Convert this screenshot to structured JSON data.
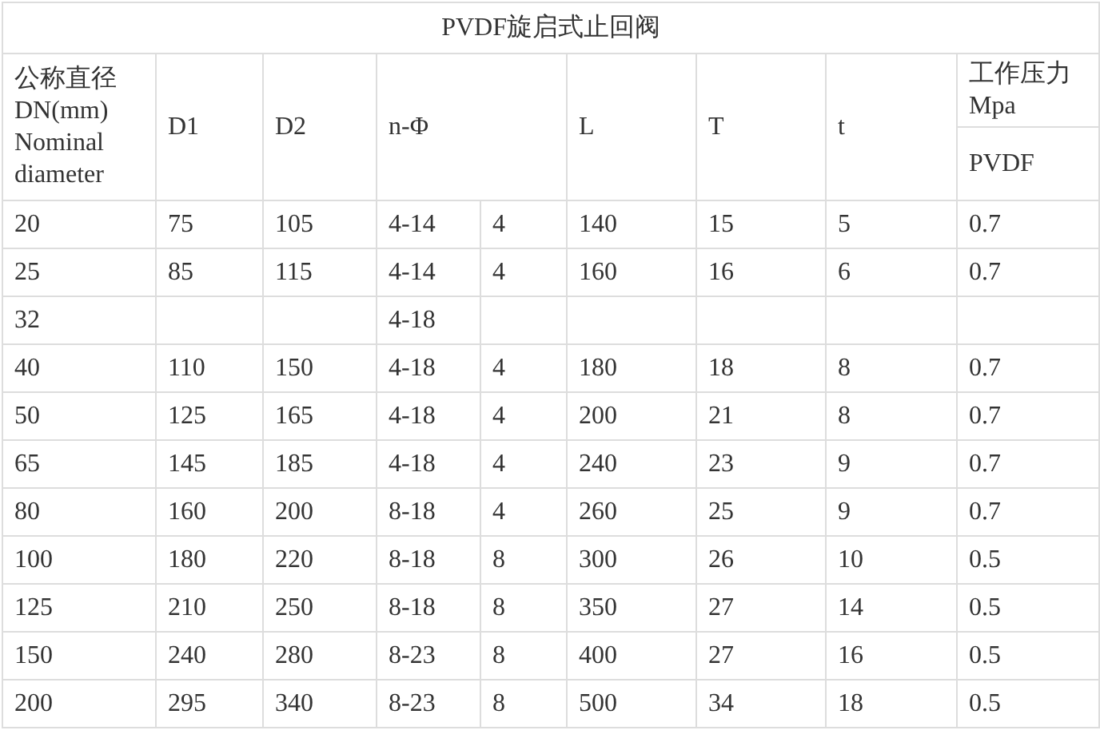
{
  "table": {
    "title": "PVDF旋启式止回阀",
    "header": {
      "size_lines": [
        "公称直径",
        "DN(mm)",
        "Nominal",
        "diameter"
      ],
      "columns": [
        "D1",
        "D2",
        "n-Φ",
        "L",
        "T",
        "t"
      ],
      "pressure": "工作压力Mpa",
      "material": "PVDF"
    },
    "rows": [
      [
        "20",
        "75",
        "105",
        "4-14",
        "4",
        "140",
        "15",
        "5",
        "0.7"
      ],
      [
        "25",
        "85",
        "115",
        "4-14",
        "4",
        "160",
        "16",
        "6",
        "0.7"
      ],
      [
        "32",
        null,
        null,
        "4-18",
        null,
        null,
        null,
        null,
        null
      ],
      [
        "40",
        "110",
        "150",
        "4-18",
        "4",
        "180",
        "18",
        "8",
        "0.7"
      ],
      [
        "50",
        "125",
        "165",
        "4-18",
        "4",
        "200",
        "21",
        "8",
        "0.7"
      ],
      [
        "65",
        "145",
        "185",
        "4-18",
        "4",
        "240",
        "23",
        "9",
        "0.7"
      ],
      [
        "80",
        "160",
        "200",
        "8-18",
        "4",
        "260",
        "25",
        "9",
        "0.7"
      ],
      [
        "100",
        "180",
        "220",
        "8-18",
        "8",
        "300",
        "26",
        "10",
        "0.5"
      ],
      [
        "125",
        "210",
        "250",
        "8-18",
        "8",
        "350",
        "27",
        "14",
        "0.5"
      ],
      [
        "150",
        "240",
        "280",
        "8-23",
        "8",
        "400",
        "27",
        "16",
        "0.5"
      ],
      [
        "200",
        "295",
        "340",
        "8-23",
        "8",
        "500",
        "34",
        "18",
        "0.5"
      ]
    ]
  }
}
